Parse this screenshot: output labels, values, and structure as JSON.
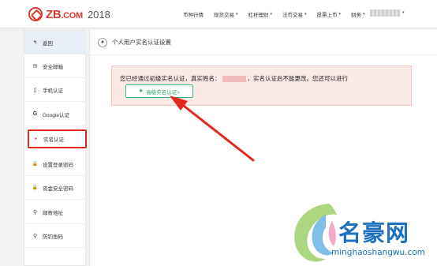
{
  "header": {
    "logo_text": "ZB",
    "logo_suffix": ".COM",
    "logo_year": "2018",
    "nav": [
      {
        "label": "币种行情",
        "dropdown": false
      },
      {
        "label": "现货交易",
        "dropdown": true
      },
      {
        "label": "杠杆理财",
        "dropdown": true
      },
      {
        "label": "法币交易",
        "dropdown": true
      },
      {
        "label": "投票上币",
        "dropdown": true
      },
      {
        "label": "财务",
        "dropdown": true
      }
    ],
    "caret": "▾"
  },
  "sidebar": {
    "items": [
      {
        "label": "返回",
        "icon": "back-arrow-icon",
        "glyph": "↰"
      },
      {
        "label": "安全邮箱",
        "icon": "envelope-icon",
        "glyph": "✉"
      },
      {
        "label": "手机认证",
        "icon": "mobile-icon",
        "glyph": "▯"
      },
      {
        "label": "Google认证",
        "icon": "google-icon",
        "glyph": "G"
      },
      {
        "label": "实名认证",
        "icon": "user-icon",
        "glyph": "●"
      },
      {
        "label": "设置登录密码",
        "icon": "lock-icon",
        "glyph": "🔒"
      },
      {
        "label": "资金安全密码",
        "icon": "lock-icon",
        "glyph": "🔒"
      },
      {
        "label": "邮寄地址",
        "icon": "map-marker-icon",
        "glyph": "⚲"
      },
      {
        "label": "防钓鱼码",
        "icon": "map-marker-icon",
        "glyph": "⚲"
      }
    ],
    "active_index": 4
  },
  "main": {
    "title": "个人用户实名认证设置",
    "alert": {
      "text_before": "您已经通过初级实名认证，真实姓名：",
      "text_after": "，实名认证后不能更改。您还可以进行",
      "button_label": "高级实名认证>",
      "button_icon": "plus-circle-icon"
    }
  },
  "watermark": {
    "name": "名豪网",
    "url": "minghaoshangwu.com"
  },
  "colors": {
    "brand": "#d43b2a",
    "highlight": "#e02a1f",
    "alert_bg": "#fbe9e6",
    "button_border": "#41b883",
    "watermark": "#1f6fbf"
  }
}
